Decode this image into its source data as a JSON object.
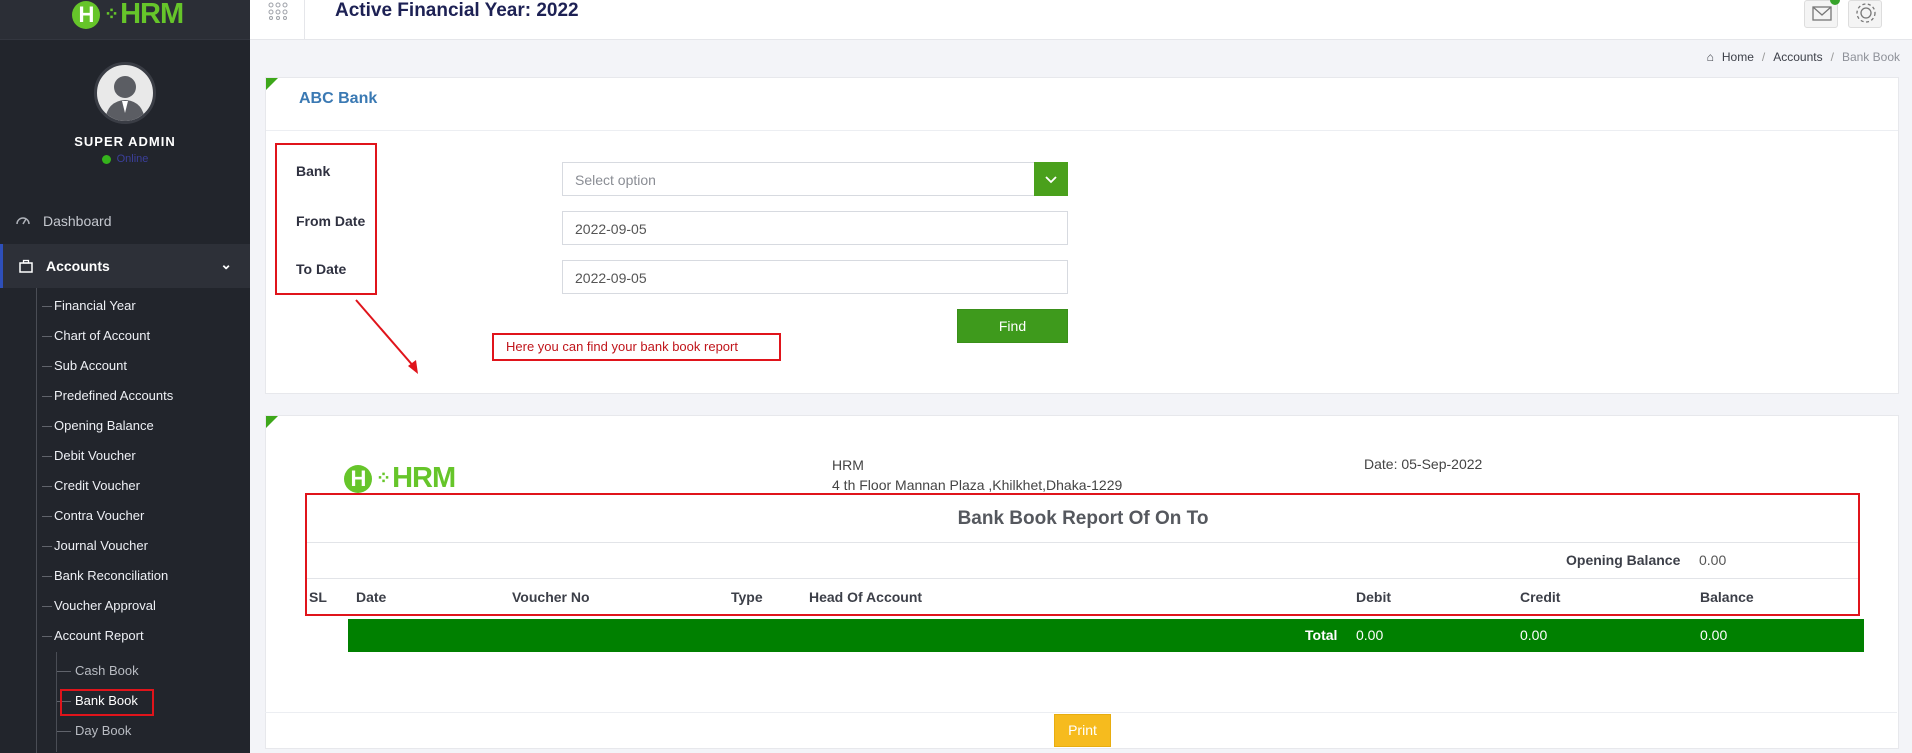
{
  "app": {
    "logo_text": "HRM"
  },
  "sidebar": {
    "user_name": "SUPER ADMIN",
    "user_status": "Online",
    "dashboard_label": "Dashboard",
    "accounts_label": "Accounts",
    "items": [
      {
        "label": "Financial Year"
      },
      {
        "label": "Chart of Account"
      },
      {
        "label": "Sub Account"
      },
      {
        "label": "Predefined Accounts"
      },
      {
        "label": "Opening Balance"
      },
      {
        "label": "Debit Voucher"
      },
      {
        "label": "Credit Voucher"
      },
      {
        "label": "Contra Voucher"
      },
      {
        "label": "Journal Voucher"
      },
      {
        "label": "Bank Reconciliation"
      },
      {
        "label": "Voucher Approval"
      },
      {
        "label": "Account Report"
      }
    ],
    "report_items": [
      {
        "label": "Cash Book"
      },
      {
        "label": "Bank Book"
      },
      {
        "label": "Day Book"
      }
    ]
  },
  "header": {
    "title": "Active Financial Year: 2022"
  },
  "breadcrumb": {
    "home": "Home",
    "section": "Accounts",
    "current": "Bank Book"
  },
  "filter": {
    "title": "ABC Bank",
    "bank_label": "Bank",
    "bank_placeholder": "Select option",
    "from_label": "From Date",
    "from_value": "2022-09-05",
    "to_label": "To Date",
    "to_value": "2022-09-05",
    "find_label": "Find",
    "annotation": "Here you can find your bank book report"
  },
  "report": {
    "company": "HRM",
    "address": "4 th Floor Mannan Plaza ,Khilkhet,Dhaka-1229",
    "date": "Date: 05-Sep-2022",
    "title": "Bank Book Report Of On To",
    "opening_balance_label": "Opening Balance",
    "opening_balance_value": "0.00",
    "columns": [
      "SL",
      "Date",
      "Voucher No",
      "Type",
      "Head Of Account",
      "Debit",
      "Credit",
      "Balance"
    ],
    "total_label": "Total",
    "total_debit": "0.00",
    "total_credit": "0.00",
    "total_balance": "0.00",
    "print_label": "Print"
  },
  "colors": {
    "accent_green": "#3e9a1c",
    "highlight_red": "#e0141b",
    "sidebar_bg": "#22252c",
    "print_yellow": "#f6bb1e"
  }
}
